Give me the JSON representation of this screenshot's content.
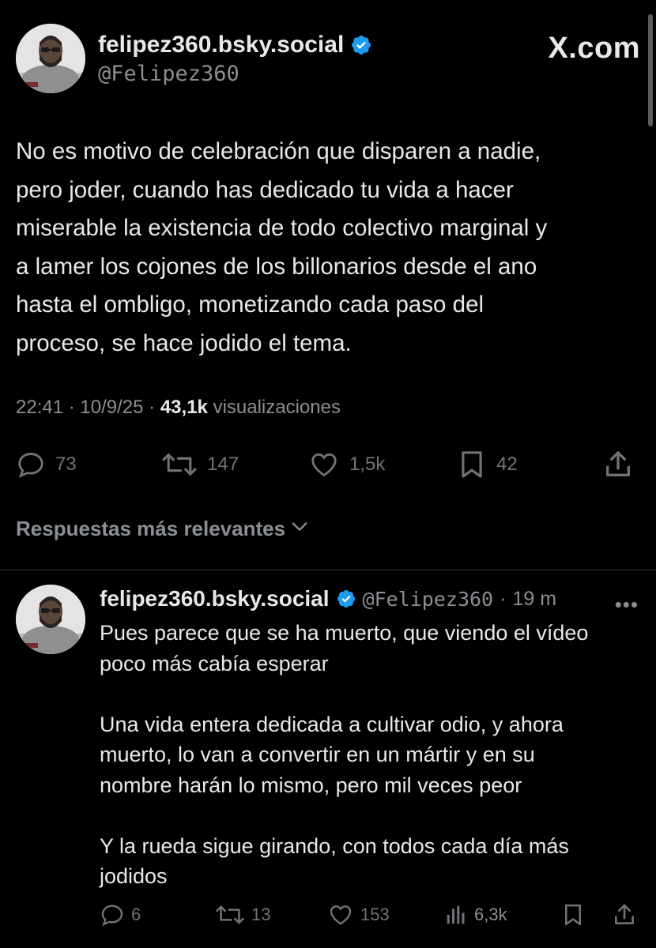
{
  "main_post": {
    "display_name": "felipez360.bsky.social",
    "handle": "@Felipez360",
    "brand": "X.com",
    "text": "No es motivo de celebración que disparen a nadie,\npero joder, cuando has dedicado tu vida a hacer\nmiserable la existencia de todo colectivo marginal y\na lamer los cojones de los billonarios desde el ano\nhasta el ombligo, monetizando cada paso del\nproceso, se hace jodido el tema.",
    "time": "22:41",
    "date": "10/9/25",
    "views_count": "43,1k",
    "views_label": "visualizaciones",
    "stats": {
      "replies": "73",
      "reposts": "147",
      "likes": "1,5k",
      "bookmarks": "42"
    },
    "icons": [
      "verified-badge-icon",
      "reply-icon",
      "repost-icon",
      "like-icon",
      "bookmark-icon",
      "share-icon"
    ]
  },
  "relevance_sort": {
    "label": "Respuestas más relevantes"
  },
  "reply": {
    "display_name": "felipez360.bsky.social",
    "handle": "@Felipez360",
    "separator": "·",
    "time": "19 m",
    "more": "•••",
    "text": "Pues parece que se ha muerto, que viendo el vídeo\npoco más cabía esperar\n\nUna vida entera dedicada a cultivar odio, y ahora\nmuerto, lo van a convertir en un mártir y en su\nnombre harán lo mismo, pero mil veces peor\n\nY la rueda sigue girando, con todos cada día más\njodidos",
    "stats": {
      "replies": "6",
      "reposts": "13",
      "likes": "153",
      "views": "6,3k"
    }
  },
  "colors": {
    "background": "#000000",
    "text": "#e7e9ea",
    "muted": "#8b8f93",
    "verified": "#1d9bf0",
    "divider": "#2f3336"
  }
}
